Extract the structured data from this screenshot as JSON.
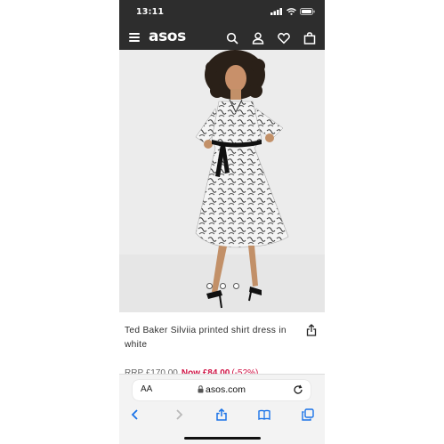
{
  "status_bar": {
    "time": "13:11"
  },
  "header": {
    "logo": "asos",
    "icons": [
      "menu-icon",
      "search-icon",
      "account-icon",
      "heart-icon",
      "bag-icon"
    ]
  },
  "product": {
    "title": "Ted Baker Silviia printed shirt dress in white",
    "rrp": "RRP £170.00",
    "now_price": "Now £84.00",
    "discount": "(-52%)",
    "carousel_dots": 3
  },
  "browser": {
    "text_size_label": "AA",
    "url": "asos.com",
    "toolbar": [
      "back-icon",
      "forward-icon",
      "share-icon",
      "bookmarks-icon",
      "tabs-icon"
    ]
  },
  "colors": {
    "header_bg": "#2d2d2d",
    "sale": "#d01345",
    "ios_blue": "#1a73e8"
  }
}
